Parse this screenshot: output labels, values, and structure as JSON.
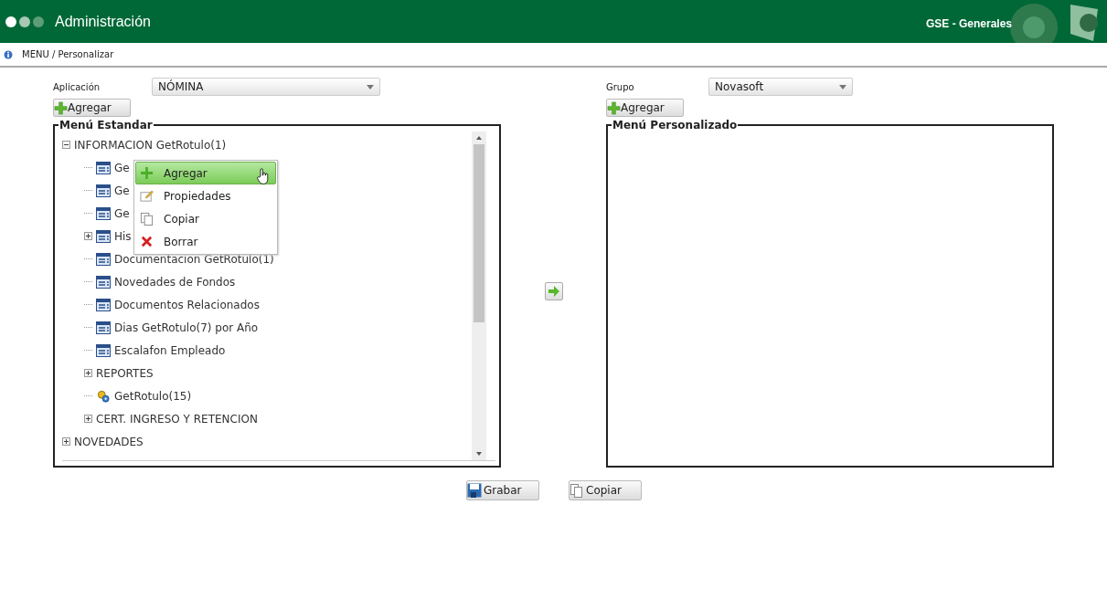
{
  "header": {
    "title": "Administración",
    "module": "GSE - Generales"
  },
  "breadcrumb": "MENU / Personalizar",
  "left": {
    "label": "Aplicación",
    "value": "NÓMINA",
    "add_button": "Agregar",
    "panel_title": "Menú Estandar",
    "tree": [
      {
        "label": "INFORMACION GetRotulo(1)",
        "expanded": true,
        "children": [
          {
            "label": "Ge",
            "kind": "form"
          },
          {
            "label": "Ge",
            "kind": "form"
          },
          {
            "label": "Ge",
            "kind": "form"
          },
          {
            "label": "His",
            "kind": "form",
            "expanded": false
          },
          {
            "label": "Documentacion GetRotulo(1)",
            "kind": "form"
          },
          {
            "label": "Novedades de Fondos",
            "kind": "form"
          },
          {
            "label": "Documentos Relacionados",
            "kind": "form"
          },
          {
            "label": "Dias GetRotulo(7) por Año",
            "kind": "form"
          },
          {
            "label": "Escalafon Empleado",
            "kind": "form"
          },
          {
            "label": "REPORTES",
            "expanded": false
          },
          {
            "label": "GetRotulo(15)",
            "kind": "report"
          },
          {
            "label": "CERT. INGRESO Y RETENCION",
            "expanded": false
          }
        ]
      },
      {
        "label": "NOVEDADES",
        "expanded": false
      }
    ]
  },
  "context_menu": [
    {
      "label": "Agregar",
      "kind": "add",
      "selected": true
    },
    {
      "label": "Propiedades",
      "kind": "properties",
      "selected": false
    },
    {
      "label": "Copiar",
      "kind": "copy",
      "selected": false
    },
    {
      "label": "Borrar",
      "kind": "delete",
      "selected": false
    }
  ],
  "right": {
    "label": "Grupo",
    "value": "Novasoft",
    "add_button": "Agregar",
    "panel_title": "Menú Personalizado"
  },
  "buttons": [
    {
      "label": "Grabar",
      "kind": "save"
    },
    {
      "label": "Copiar",
      "kind": "copy"
    }
  ]
}
